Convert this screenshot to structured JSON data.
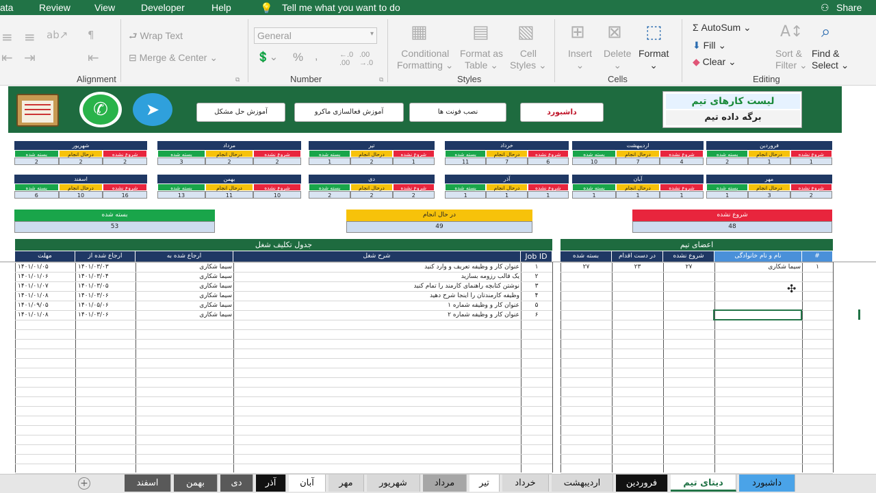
{
  "titlebar": {
    "items": [
      "ata",
      "Review",
      "View",
      "Developer",
      "Help"
    ],
    "tell": "Tell me what you want to do",
    "share": "Share"
  },
  "ribbon": {
    "wrap_text": "Wrap Text",
    "merge_center": "Merge & Center",
    "alignment": "Alignment",
    "number_format": "General",
    "number": "Number",
    "cond_fmt": [
      "Conditional",
      "Formatting"
    ],
    "fmt_table": [
      "Format as",
      "Table"
    ],
    "cell_styles": [
      "Cell",
      "Styles"
    ],
    "styles": "Styles",
    "insert": "Insert",
    "delete": "Delete",
    "format": "Format",
    "cells": "Cells",
    "autosum": "AutoSum",
    "fill": "Fill",
    "clear": "Clear",
    "sort": [
      "Sort &",
      "Filter"
    ],
    "find": [
      "Find &",
      "Select"
    ],
    "editing": "Editing"
  },
  "banner": {
    "buttons": [
      "آموزش حل مشکل",
      "آموزش فعالسازی ماکرو",
      "نصب فونت ها",
      "داشبورد"
    ],
    "title1": "لیست کارهای تیم",
    "title2": "برگه داده تیم"
  },
  "status_labels": {
    "not_started": "شروع نشده",
    "in_progress": "درحال انجام",
    "closed": "بسته شده"
  },
  "months": [
    {
      "name": "فروردین",
      "ns": 1,
      "ip": 1,
      "cl": 2
    },
    {
      "name": "اردیبهشت",
      "ns": 4,
      "ip": 7,
      "cl": 10
    },
    {
      "name": "خرداد",
      "ns": 6,
      "ip": 7,
      "cl": 11
    },
    {
      "name": "تیر",
      "ns": 1,
      "ip": 2,
      "cl": 1
    },
    {
      "name": "مرداد",
      "ns": 2,
      "ip": 2,
      "cl": 3
    },
    {
      "name": "شهریور",
      "ns": 2,
      "ip": 2,
      "cl": 2
    },
    {
      "name": "مهر",
      "ns": 2,
      "ip": 3,
      "cl": 1
    },
    {
      "name": "آبان",
      "ns": 1,
      "ip": 1,
      "cl": 1
    },
    {
      "name": "آذر",
      "ns": 1,
      "ip": 1,
      "cl": 1
    },
    {
      "name": "دی",
      "ns": 2,
      "ip": 2,
      "cl": 2
    },
    {
      "name": "بهمن",
      "ns": 10,
      "ip": 11,
      "cl": 13
    },
    {
      "name": "اسفند",
      "ns": 16,
      "ip": 10,
      "cl": 6
    }
  ],
  "totals": {
    "closed_label": "بسته شده",
    "closed": "53",
    "inprog_label": "در حال انجام",
    "inprog": "49",
    "notstart_label": "شروع نشده",
    "notstart": "48"
  },
  "jobs": {
    "title": "جدول تکلیف شغل",
    "headers": {
      "deadline": "مهلت",
      "assigned_from": "ارجاع شده از",
      "assigned_to": "ارجاع شده به",
      "desc": "شرح شغل",
      "id": "Job ID"
    },
    "rows": [
      {
        "deadline": "۱۴۰۱/۰۱/۰۵",
        "from": "۱۴۰۱/۰۳/۰۳",
        "to": "سیما شکاری",
        "desc": "عنوان کار و وظیفه تعریف و وارد کنید",
        "id": "۱"
      },
      {
        "deadline": "۱۴۰۱/۰۱/۰۶",
        "from": "۱۴۰۱/۰۳/۰۴",
        "to": "سیما شکاری",
        "desc": "یک قالب رزومه بسازید",
        "id": "۲"
      },
      {
        "deadline": "۱۴۰۱/۰۱/۰۷",
        "from": "۱۴۰۱/۰۳/۰۵",
        "to": "سیما شکاری",
        "desc": "نوشتن کتابچه راهنمای کارمند را تمام کنید",
        "id": "۳"
      },
      {
        "deadline": "۱۴۰۱/۰۱/۰۸",
        "from": "۱۴۰۱/۰۳/۰۶",
        "to": "سیما شکاری",
        "desc": "وظیفه کارمندتان را اینجا شرح دهید",
        "id": "۴"
      },
      {
        "deadline": "۱۴۰۱/۰۹/۰۵",
        "from": "۱۴۰۱/۰۵/۰۶",
        "to": "سیما شکاری",
        "desc": "عنوان کار و وظیفه شماره ۱",
        "id": "۵"
      },
      {
        "deadline": "۱۴۰۱/۰۱/۰۸",
        "from": "۱۴۰۱/۰۳/۰۶",
        "to": "سیما شکاری",
        "desc": "عنوان کار و وظیفه شماره ۲",
        "id": "۶"
      }
    ]
  },
  "team": {
    "title": "اعضای تیم",
    "headers": {
      "closed": "بسته شده",
      "in_action": "در دست اقدام",
      "not_started": "شروع نشده",
      "name": "نام و نام خانوادگی",
      "num": "#"
    },
    "rows": [
      {
        "closed": "۲۷",
        "in_action": "۲۳",
        "not_started": "۲۷",
        "name": "سیما شکاری",
        "num": "۱"
      }
    ]
  },
  "tabs": [
    "اسفند",
    "بهمن",
    "دی",
    "آذر",
    "آبان",
    "مهر",
    "شهریور",
    "مرداد",
    "تیر",
    "خرداد",
    "اردیبهشت",
    "فروردین",
    "دیتای تیم",
    "داشبورد"
  ],
  "colors": {
    "excel_green": "#217346",
    "banner": "#1e6b3f",
    "navy": "#1f3864",
    "red": "#e8253d",
    "yellow": "#f7c20a",
    "green": "#19a54a"
  }
}
